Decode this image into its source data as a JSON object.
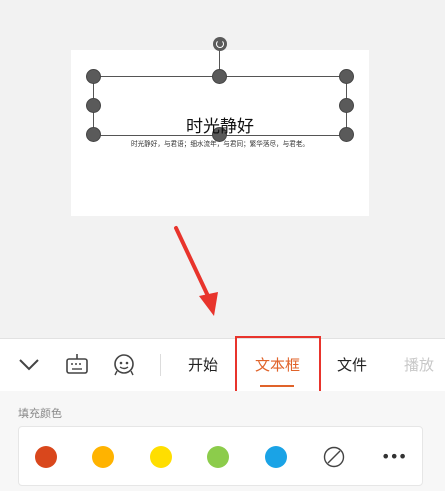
{
  "slide": {
    "title": "时光静好",
    "subtitle": "时光静好，与君语；细水流年，与君同；繁华落尽，与君老。"
  },
  "toolbar": {
    "tabs": [
      {
        "label": "开始",
        "active": false
      },
      {
        "label": "文本框",
        "active": true
      },
      {
        "label": "文件",
        "active": false
      },
      {
        "label": "播放",
        "active": false
      }
    ],
    "icons": [
      "chevron-down-icon",
      "keyboard-icon",
      "emoji-icon"
    ]
  },
  "fill_panel": {
    "label": "填充颜色",
    "colors": [
      "#d9471c",
      "#ffb300",
      "#ffde00",
      "#8ccc4b",
      "#1aa3e6"
    ],
    "no_fill_icon": "no-fill-icon",
    "more_label": "•••"
  },
  "accent_color": "#e0632a",
  "highlight_color": "#e8342c"
}
